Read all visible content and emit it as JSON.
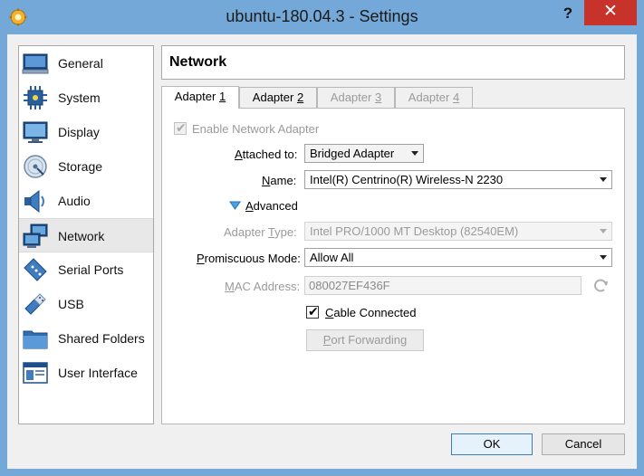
{
  "window": {
    "title": "ubuntu-180.04.3 - Settings",
    "help": "?",
    "close": "✕"
  },
  "sidebar": {
    "items": [
      {
        "label": "General",
        "icon": "general-icon"
      },
      {
        "label": "System",
        "icon": "system-icon"
      },
      {
        "label": "Display",
        "icon": "display-icon"
      },
      {
        "label": "Storage",
        "icon": "storage-icon"
      },
      {
        "label": "Audio",
        "icon": "audio-icon"
      },
      {
        "label": "Network",
        "icon": "network-icon",
        "selected": true
      },
      {
        "label": "Serial Ports",
        "icon": "serial-ports-icon"
      },
      {
        "label": "USB",
        "icon": "usb-icon"
      },
      {
        "label": "Shared Folders",
        "icon": "shared-folders-icon"
      },
      {
        "label": "User Interface",
        "icon": "user-interface-icon"
      }
    ]
  },
  "header": {
    "title": "Network"
  },
  "tabs": [
    {
      "prefix": "Adapter ",
      "key": "1",
      "active": true
    },
    {
      "prefix": "Adapter ",
      "key": "2"
    },
    {
      "prefix": "Adapter ",
      "key": "3",
      "disabled": true
    },
    {
      "prefix": "Adapter ",
      "key": "4",
      "disabled": true
    }
  ],
  "adapter": {
    "enable_label": "Enable Network Adapter",
    "attached_label_key": "A",
    "attached_label_rest": "ttached to:",
    "attached_value": "Bridged Adapter",
    "name_label_key": "N",
    "name_label_rest": "ame:",
    "name_value": "Intel(R) Centrino(R) Wireless-N 2230",
    "advanced_key": "A",
    "advanced_rest": "dvanced",
    "adapter_type_label_pre": "Adapter ",
    "adapter_type_label_key": "T",
    "adapter_type_label_rest": "ype:",
    "adapter_type_value": "Intel PRO/1000 MT Desktop (82540EM)",
    "promiscuous_label_key": "P",
    "promiscuous_label_rest": "romiscuous Mode:",
    "promiscuous_value": "Allow All",
    "mac_label_key": "M",
    "mac_label_rest": "AC Address:",
    "mac_value": "080027EF436F",
    "cable_key": "C",
    "cable_rest": "able Connected",
    "port_forwarding_key": "P",
    "port_forwarding_rest": "ort Forwarding"
  },
  "footer": {
    "ok": "OK",
    "cancel": "Cancel"
  }
}
